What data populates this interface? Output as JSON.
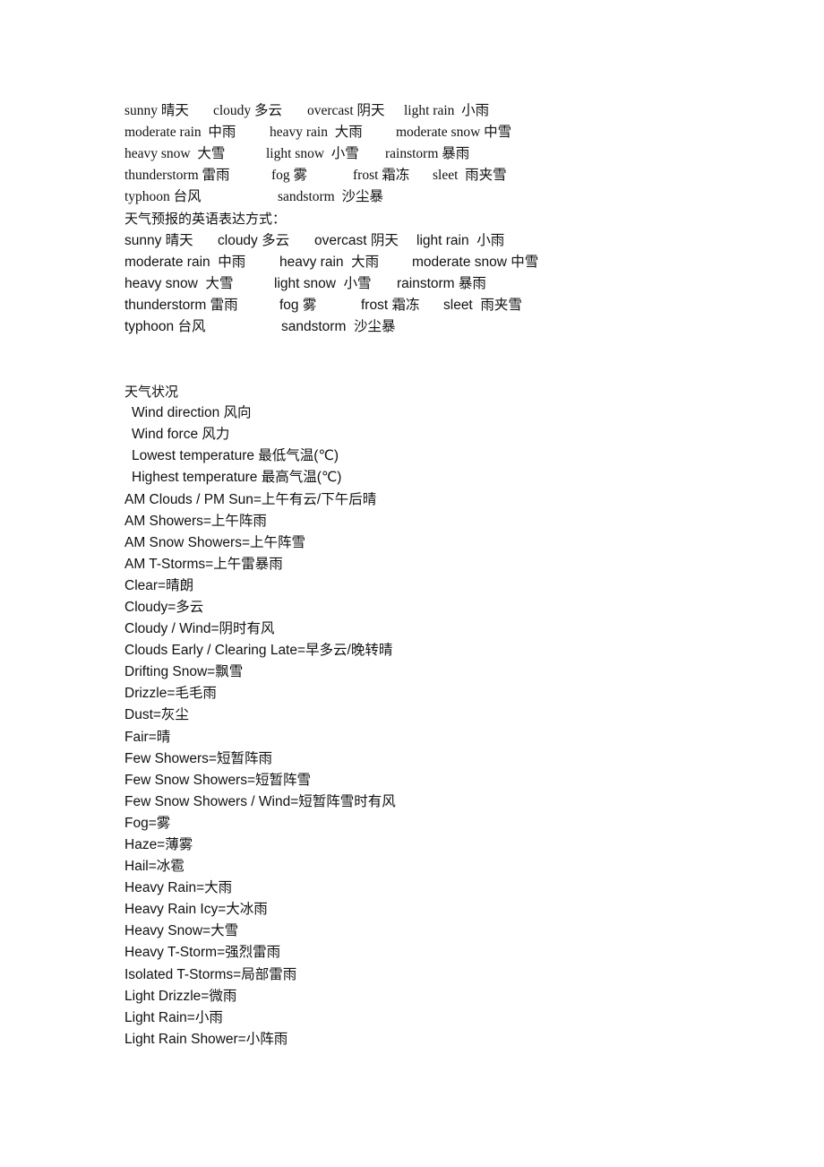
{
  "block1": {
    "rows": [
      [
        "sunny 晴天",
        "cloudy 多云",
        "overcast 阴天",
        "light rain  小雨"
      ],
      [
        "moderate rain  中雨",
        "heavy rain  大雨",
        "moderate snow 中雪"
      ],
      [
        "heavy snow  大雪",
        "light snow  小雪",
        "rainstorm 暴雨"
      ],
      [
        "thunderstorm 雷雨",
        "fog 雾",
        "frost 霜冻",
        "sleet  雨夹雪"
      ],
      [
        "typhoon 台风",
        "sandstorm  沙尘暴"
      ]
    ]
  },
  "block2": {
    "heading": "天气预报的英语表达方式：",
    "rows": [
      [
        "sunny 晴天",
        "cloudy 多云",
        "overcast 阴天",
        "light rain  小雨"
      ],
      [
        "moderate rain  中雨",
        "heavy rain  大雨",
        "moderate snow 中雪"
      ],
      [
        "heavy snow  大雪",
        "light snow  小雪",
        "rainstorm 暴雨"
      ],
      [
        "thunderstorm 雷雨",
        "fog 雾",
        "frost 霜冻",
        "sleet  雨夹雪"
      ],
      [
        "typhoon 台风",
        "sandstorm  沙尘暴"
      ]
    ]
  },
  "block3": {
    "heading": "天气状况",
    "sub_items": [
      "Wind direction 风向",
      "Wind force  风力",
      "Lowest temperature 最低气温(℃)",
      "Highest temperature 最高气温(℃)"
    ],
    "terms": [
      "AM Clouds / PM Sun=上午有云/下午后晴",
      "AM Showers=上午阵雨",
      "AM Snow Showers=上午阵雪",
      "AM T-Storms=上午雷暴雨",
      "Clear=晴朗",
      "Cloudy=多云",
      "Cloudy / Wind=阴时有风",
      "Clouds Early / Clearing Late=早多云/晚转晴",
      "Drifting Snow=飘雪",
      "Drizzle=毛毛雨",
      "Dust=灰尘",
      "Fair=晴",
      "Few Showers=短暂阵雨",
      "Few Snow Showers=短暂阵雪",
      "Few Snow Showers / Wind=短暂阵雪时有风",
      "Fog=雾",
      "Haze=薄雾",
      "Hail=冰雹",
      "Heavy Rain=大雨",
      "Heavy Rain Icy=大冰雨",
      "Heavy Snow=大雪",
      "Heavy T-Storm=强烈雷雨",
      "Isolated T-Storms=局部雷雨",
      "Light Drizzle=微雨",
      "Light Rain=小雨",
      "Light Rain Shower=小阵雨"
    ]
  }
}
